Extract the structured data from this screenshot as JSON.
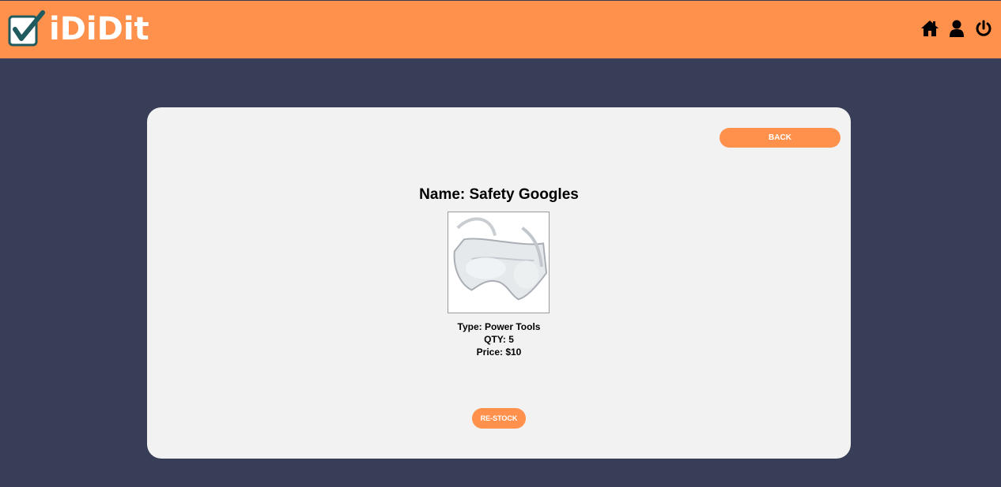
{
  "header": {
    "logo_text": "iDiDit",
    "brand_color": "#ff914d",
    "icons": [
      "home-icon",
      "user-icon",
      "power-icon"
    ]
  },
  "product": {
    "back_label": "BACK",
    "name": "Name: Safety Googles",
    "type": "Type: Power Tools",
    "qty": "QTY: 5",
    "price": "Price: $10",
    "restock_label": "RE-STOCK"
  },
  "colors": {
    "background": "#393e58",
    "card": "#f1f2f1",
    "accent": "#ff914d"
  }
}
